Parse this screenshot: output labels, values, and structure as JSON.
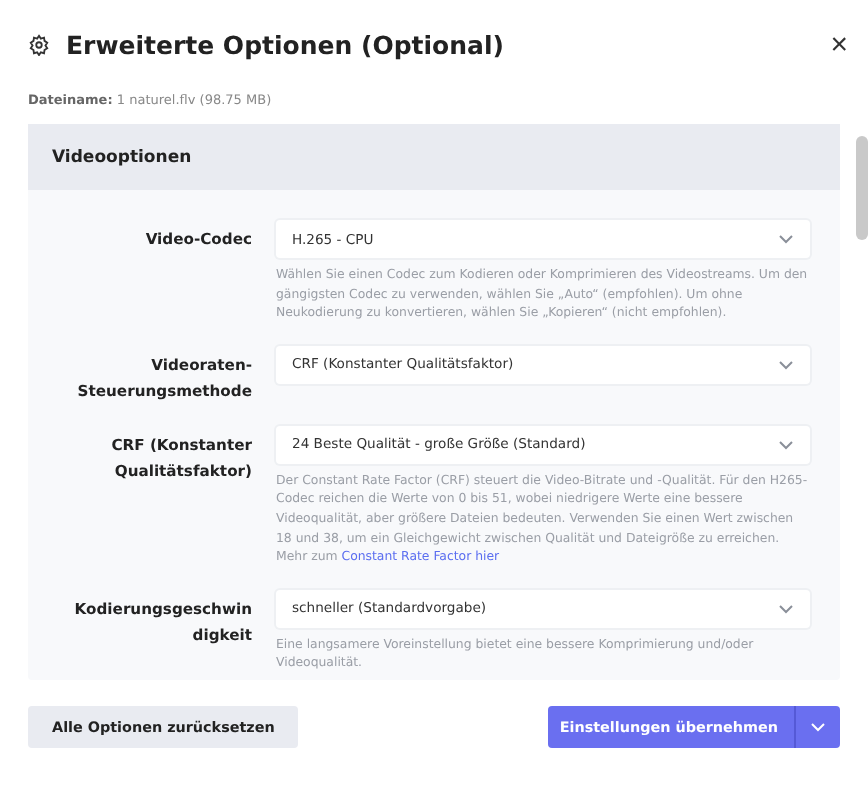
{
  "dialog": {
    "title": "Erweiterte Optionen (Optional)",
    "close": "×"
  },
  "file": {
    "label": "Dateiname:",
    "value": "1 naturel.flv (98.75 MB)"
  },
  "section": {
    "title": "Videooptionen",
    "fields": [
      {
        "label": "Video-Codec",
        "value": "H.265 - CPU",
        "description": "Wählen Sie einen Codec zum Kodieren oder Komprimieren des Videostreams. Um den gängigsten Codec zu verwenden, wählen Sie „Auto“ (empfohlen). Um ohne Neukodierung zu konvertieren, wählen Sie „Kopieren“ (nicht empfohlen)."
      },
      {
        "label": "Videoraten-Steuerungsmethode",
        "value": "CRF (Konstanter Qualitätsfaktor)"
      },
      {
        "label": "CRF (Konstanter Qualitätsfaktor)",
        "value": "24 Beste Qualität - große Größe (Standard)",
        "description": "Der Constant Rate Factor (CRF) steuert die Video-Bitrate und -Qualität. Für den H265-Codec reichen die Werte von 0 bis 51, wobei niedrigere Werte eine bessere Videoqualität, aber größere Dateien bedeuten. Verwenden Sie einen Wert zwischen 18 und 38, um ein Gleichgewicht zwischen Qualität und Dateigröße zu erreichen. Mehr zum",
        "link": "Constant Rate Factor hier"
      },
      {
        "label_lines": [
          "Kodierungsgeschwin",
          "digkeit"
        ],
        "value": "schneller (Standardvorgabe)",
        "description": "Eine langsamere Voreinstellung bietet eine bessere Komprimierung und/oder Videoqualität."
      }
    ]
  },
  "buttons": {
    "reset": "Alle Optionen zurücksetzen",
    "apply": "Einstellungen übernehmen"
  }
}
